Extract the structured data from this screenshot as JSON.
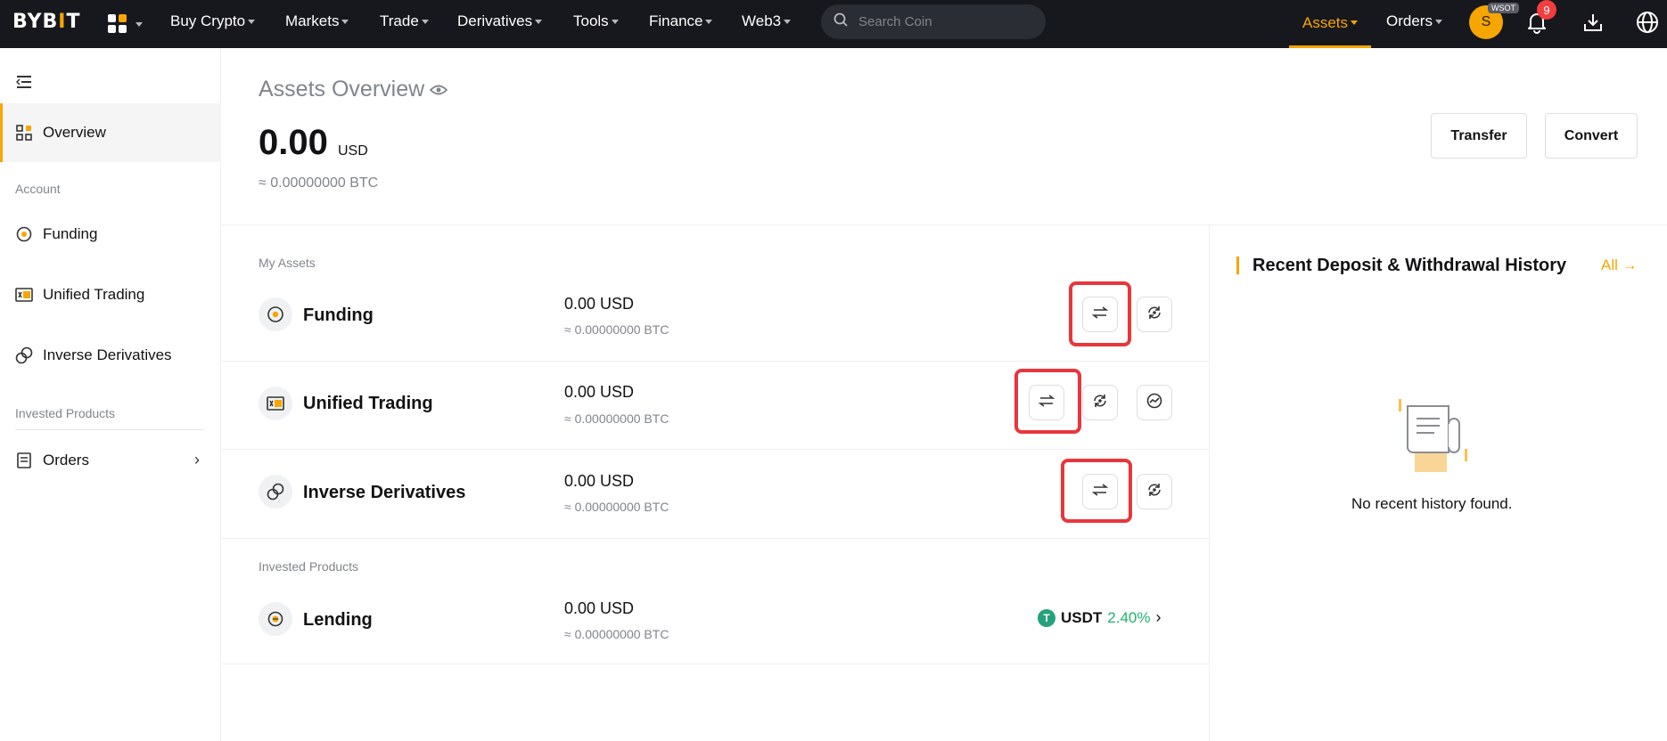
{
  "nav": {
    "logo": "BYBIT",
    "menu": [
      {
        "label": "Buy Crypto",
        "caret": true
      },
      {
        "label": "Markets",
        "caret": true
      },
      {
        "label": "Trade",
        "caret": true
      },
      {
        "label": "Derivatives",
        "caret": true
      },
      {
        "label": "Tools",
        "caret": true
      },
      {
        "label": "Finance",
        "caret": true
      },
      {
        "label": "Web3",
        "caret": true
      }
    ],
    "search_placeholder": "Search Coin",
    "assets_label": "Assets",
    "orders_label": "Orders",
    "avatar_initial": "S",
    "avatar_tag": "WSOT",
    "notification_count": "9",
    "accent_color": "#f7a600"
  },
  "sidebar": {
    "overview_label": "Overview",
    "account_section": "Account",
    "items": [
      {
        "label": "Funding",
        "icon": "funding-icon"
      },
      {
        "label": "Unified Trading",
        "icon": "unified-trading-icon"
      },
      {
        "label": "Inverse Derivatives",
        "icon": "inverse-derivatives-icon"
      }
    ],
    "invested_section": "Invested Products",
    "orders_label": "Orders"
  },
  "overview": {
    "title": "Assets Overview",
    "balance": "0.00",
    "balance_unit": "USD",
    "balance_btc": "≈ 0.00000000 BTC",
    "transfer_label": "Transfer",
    "convert_label": "Convert"
  },
  "my_assets": {
    "label": "My Assets",
    "rows": [
      {
        "name": "Funding",
        "value": "0.00 USD",
        "btc": "≈ 0.00000000 BTC"
      },
      {
        "name": "Unified Trading",
        "value": "0.00 USD",
        "btc": "≈ 0.00000000 BTC"
      },
      {
        "name": "Inverse Derivatives",
        "value": "0.00 USD",
        "btc": "≈ 0.00000000 BTC"
      }
    ]
  },
  "invested": {
    "label": "Invested Products",
    "lending": {
      "name": "Lending",
      "value": "0.00 USD",
      "btc": "≈ 0.00000000 BTC",
      "coin": "USDT",
      "coin_letter": "T",
      "apr": "2.40%"
    }
  },
  "history": {
    "title": "Recent Deposit & Withdrawal History",
    "all_label": "All",
    "empty_text": "No recent history found."
  },
  "colors": {
    "highlight": "#e8363c",
    "positive": "#20b26c"
  }
}
